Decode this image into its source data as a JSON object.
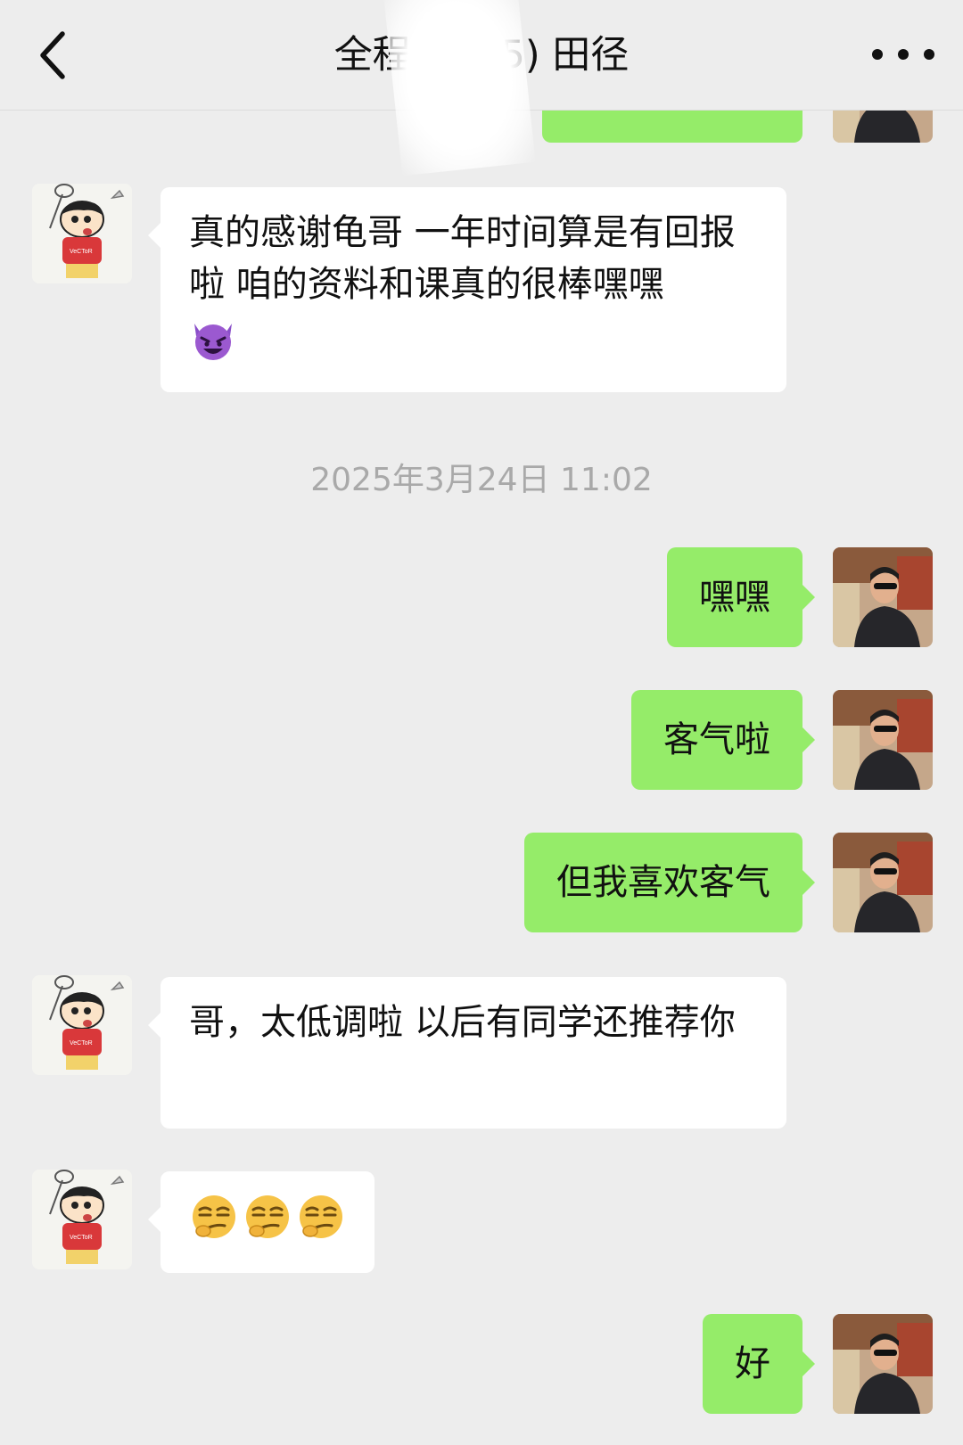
{
  "header": {
    "title": "全程班 (25) 田径",
    "back_icon": "chevron-left-icon",
    "more_icon": "more-horizontal-icon"
  },
  "messages": [
    {
      "side": "out",
      "text": ""
    },
    {
      "side": "in",
      "text": "真的感谢龟哥 一年时间算是有回报啦 咱的资料和课真的很棒嘿嘿",
      "emoji": "smiling-devil-icon"
    },
    {
      "side": "out",
      "text": "嘿嘿"
    },
    {
      "side": "out",
      "text": "客气啦"
    },
    {
      "side": "out",
      "text": "但我喜欢客气"
    },
    {
      "side": "in",
      "text": "哥，太低调啦 以后有同学还推荐你"
    },
    {
      "side": "in",
      "emoji": [
        "smirk-face-icon",
        "smirk-face-icon",
        "smirk-face-icon"
      ]
    },
    {
      "side": "out",
      "text": "好"
    }
  ],
  "timestamp": "2025年3月24日 11:02",
  "colors": {
    "background": "#ededed",
    "incoming_bubble": "#ffffff",
    "outgoing_bubble": "#95ec69",
    "timestamp_text": "#a9a9a9"
  }
}
